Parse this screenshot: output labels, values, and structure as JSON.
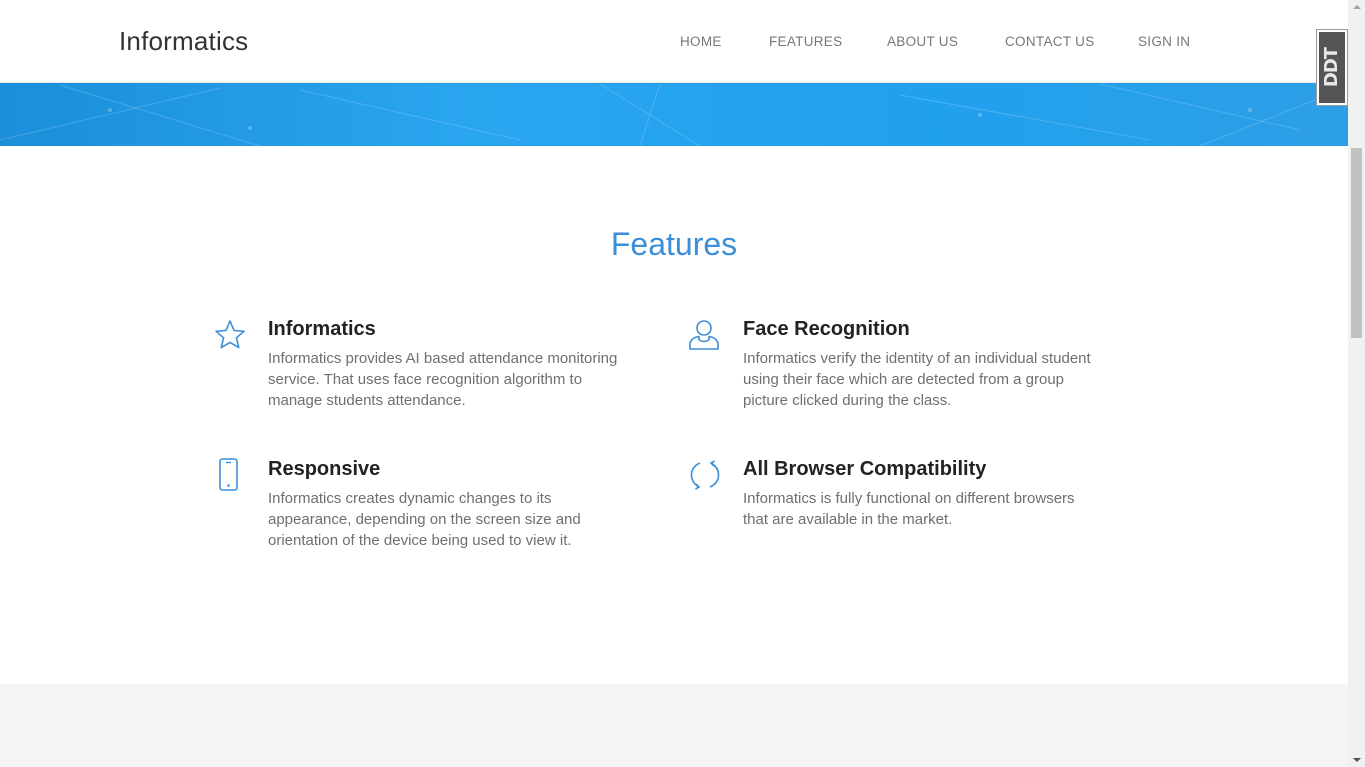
{
  "navbar": {
    "brand": "Informatics",
    "links": [
      "HOME",
      "FEATURES",
      "ABOUT US",
      "CONTACT US",
      "SIGN IN"
    ]
  },
  "widget": {
    "text": "DDT"
  },
  "features": {
    "title": "Features",
    "items": [
      {
        "icon": "star-icon",
        "title": "Informatics",
        "text": "Informatics provides AI based attendance monitoring service. That uses face recognition algorithm to manage students attendance."
      },
      {
        "icon": "user-icon",
        "title": "Face Recognition",
        "text": "Informatics verify the identity of an individual student using their face which are detected from a group picture clicked during the class."
      },
      {
        "icon": "mobile-icon",
        "title": "Responsive",
        "text": "Informatics creates dynamic changes to its appearance, depending on the screen size and orientation of the device being used to view it."
      },
      {
        "icon": "refresh-icon",
        "title": "All Browser Compatibility",
        "text": "Informatics is fully functional on different browsers that are available in the market."
      }
    ]
  },
  "colors": {
    "accent": "#3b8fd8",
    "hero": "#2aa5f0",
    "text": "#6f6f6f"
  }
}
